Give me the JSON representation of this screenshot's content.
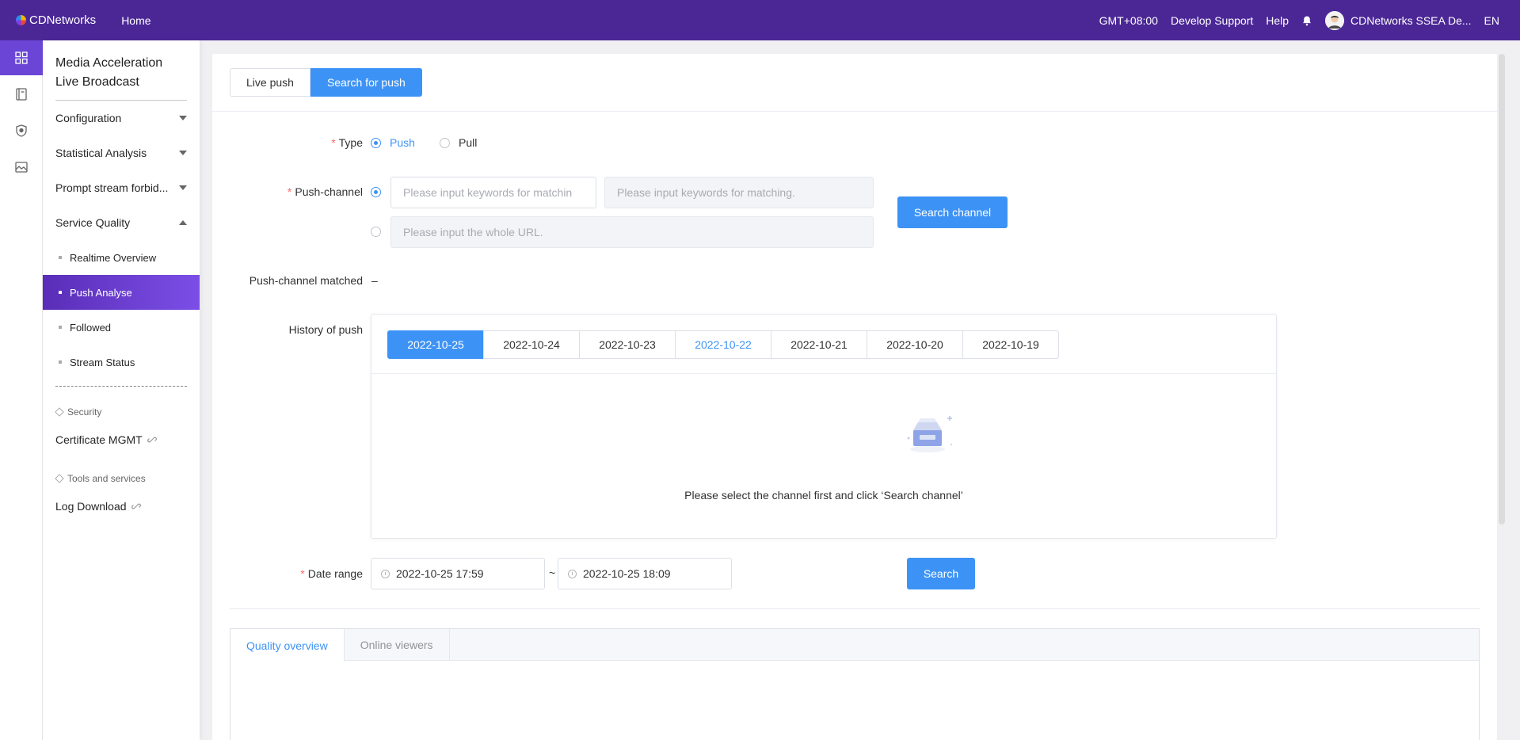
{
  "topbar": {
    "brand": "CDNetworks",
    "home": "Home",
    "timezone": "GMT+08:00",
    "develop_support": "Develop Support",
    "help": "Help",
    "user": "CDNetworks SSEA De...",
    "language": "EN"
  },
  "rail": {
    "icons": [
      "dashboard-icon",
      "document-icon",
      "shield-icon",
      "image-icon"
    ]
  },
  "menu": {
    "title_line1": "Media Acceleration",
    "title_line2": "Live Broadcast",
    "groups": {
      "configuration": "Configuration",
      "statistical": "Statistical Analysis",
      "prompt": "Prompt stream forbid...",
      "service_quality": "Service Quality"
    },
    "sub": {
      "realtime": "Realtime Overview",
      "push_analyse": "Push Analyse",
      "followed": "Followed",
      "stream_status": "Stream Status"
    },
    "security_section": "Security",
    "certificate": "Certificate MGMT",
    "tools_section": "Tools and services",
    "log_download": "Log Download"
  },
  "tabs": {
    "live_push": "Live push",
    "search_for_push": "Search for push"
  },
  "form": {
    "type_label": "Type",
    "type_push": "Push",
    "type_pull": "Pull",
    "channel_label": "Push-channel",
    "keyword_placeholder_1": "Please input keywords for matchin",
    "keyword_placeholder_2": "Please input keywords for matching.",
    "url_placeholder": "Please input the whole URL.",
    "search_channel": "Search channel",
    "matched_label": "Push-channel matched",
    "matched_value": "–",
    "history_label": "History of push",
    "history_dates": [
      "2022-10-25",
      "2022-10-24",
      "2022-10-23",
      "2022-10-22",
      "2022-10-21",
      "2022-10-20",
      "2022-10-19"
    ],
    "empty_text": "Please select the channel first and click ‘Search channel’",
    "date_range_label": "Date range",
    "start": "2022-10-25 17:59",
    "tilde": "~",
    "end": "2022-10-25 18:09",
    "search": "Search"
  },
  "bottom_tabs": {
    "quality": "Quality overview",
    "online": "Online viewers"
  },
  "colors": {
    "topbar": "#4b2796",
    "primary": "#3d93f5",
    "active_menu": "#6b46d6",
    "required": "#f56c6c"
  }
}
